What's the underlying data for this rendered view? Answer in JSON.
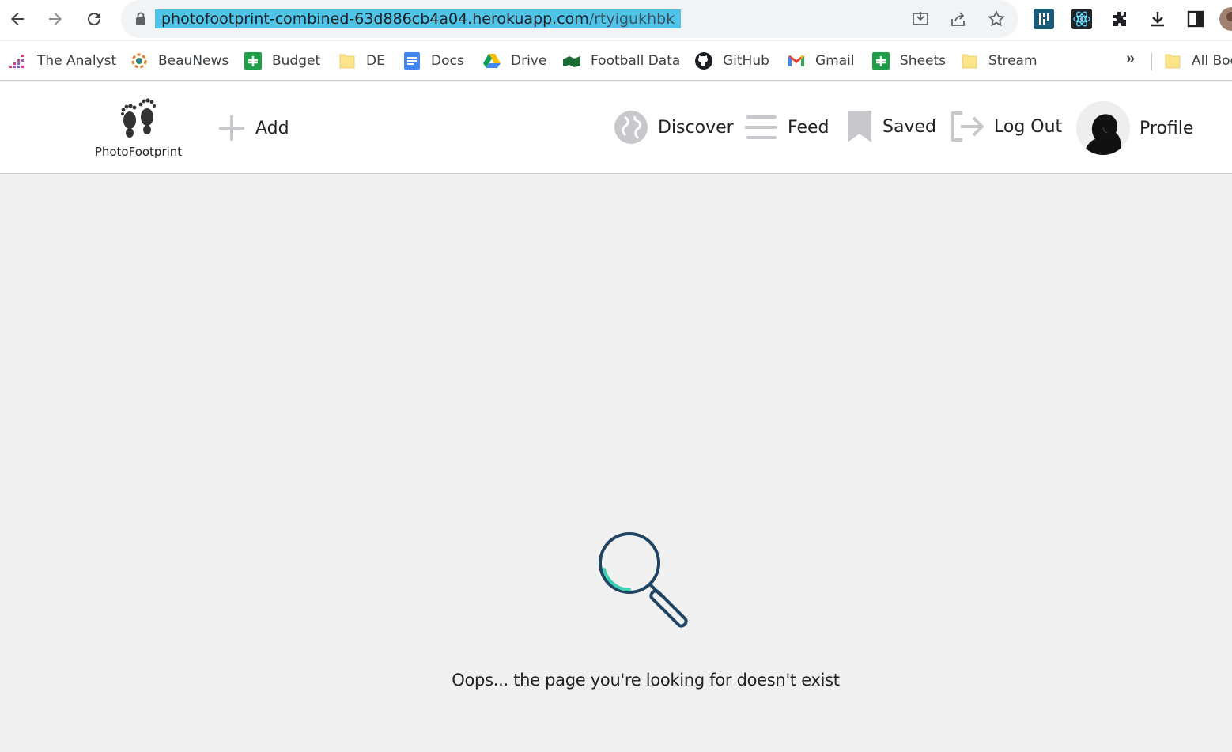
{
  "browser": {
    "url_host": "photofootprint-combined-63d886cb4a04.herokuapp.com",
    "url_path": "/rtyigukhbk",
    "icons": [
      "back-arrow-icon",
      "forward-arrow-icon",
      "reload-icon",
      "lock-icon",
      "install-icon",
      "share-icon",
      "star-icon",
      "extension-icon",
      "react-icon",
      "puzzle-icon",
      "download-icon",
      "side-panel-icon"
    ]
  },
  "bookmarks": {
    "items": [
      {
        "label": "The Analyst",
        "icon": "analyst-icon"
      },
      {
        "label": "BeauNews",
        "icon": "beaunews-icon"
      },
      {
        "label": "Budget",
        "icon": "sheets-icon"
      },
      {
        "label": "DE",
        "icon": "folder-icon"
      },
      {
        "label": "Docs",
        "icon": "docs-icon"
      },
      {
        "label": "Drive",
        "icon": "drive-icon"
      },
      {
        "label": "Football Data",
        "icon": "football-data-icon"
      },
      {
        "label": "GitHub",
        "icon": "github-icon"
      },
      {
        "label": "Gmail",
        "icon": "gmail-icon"
      },
      {
        "label": "Sheets",
        "icon": "sheets-icon"
      },
      {
        "label": "Stream",
        "icon": "folder-icon"
      }
    ],
    "more": "»",
    "all_bookmarks": "All Boo"
  },
  "header": {
    "logo_text": "PhotoFootprint",
    "add_label": "Add",
    "discover_label": "Discover",
    "feed_label": "Feed",
    "saved_label": "Saved",
    "logout_label": "Log Out",
    "profile_label": "Profile"
  },
  "main": {
    "message": "Oops... the page you're looking for doesn't exist"
  },
  "colors": {
    "url_highlight": "#4fc3e8",
    "magnifier_stroke": "#1f4463",
    "magnifier_accent": "#3ccfb0",
    "page_background": "#f0f0f0",
    "nav_icon_gray": "#c7c7cc"
  }
}
